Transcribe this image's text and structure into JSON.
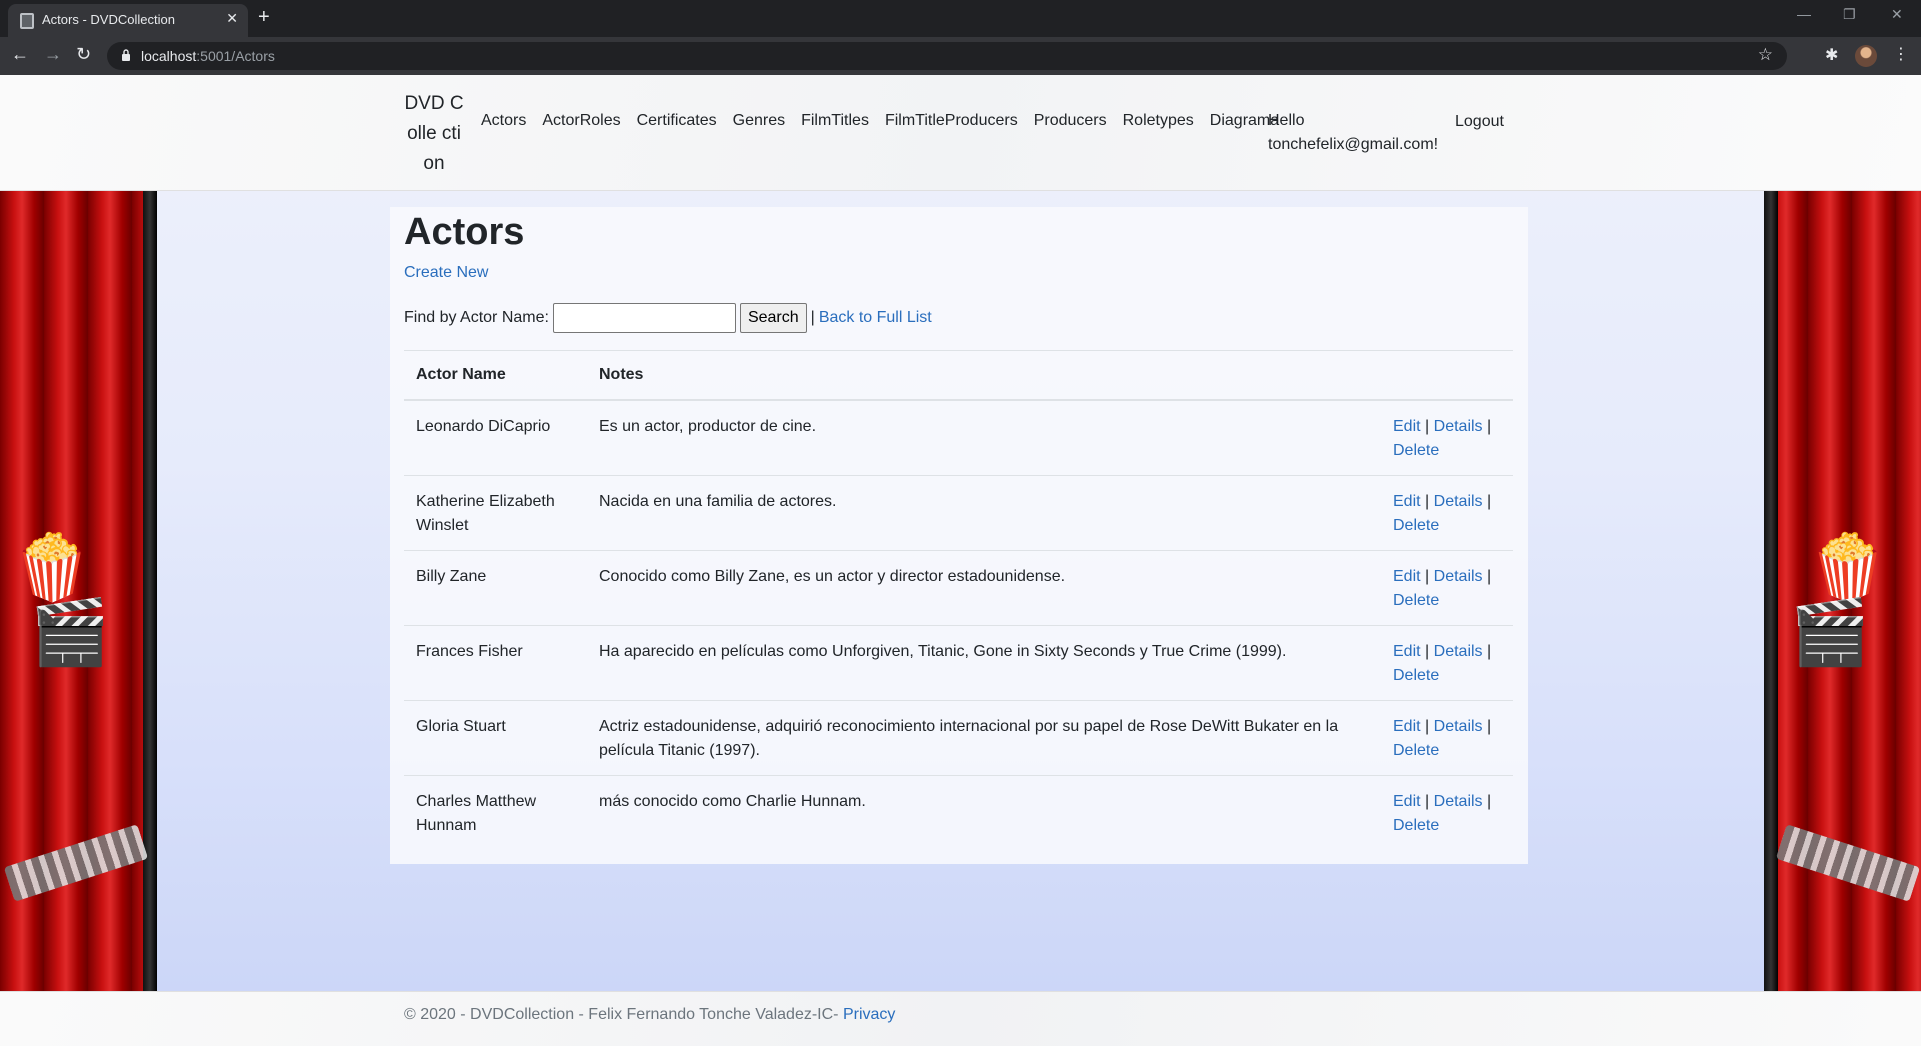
{
  "browser": {
    "tab_title": "Actors - DVDCollection",
    "url_host": "localhost",
    "url_rest": ":5001/Actors"
  },
  "site": {
    "brand": "DVD Colle ction",
    "nav": [
      "Actors",
      "ActorRoles",
      "Certificates",
      "Genres",
      "FilmTitles",
      "FilmTitleProducers",
      "Producers",
      "Roletypes",
      "Diagrama"
    ],
    "hello_line1": "Hello",
    "hello_line2": "tonchefelix@gmail.com!",
    "logout": "Logout"
  },
  "main": {
    "title": "Actors",
    "create_new": "Create New",
    "search_label": "Find by Actor Name:",
    "search_value": "",
    "search_button": "Search",
    "separator": "|",
    "back_link": "Back to Full List",
    "columns": [
      "Actor Name",
      "Notes"
    ],
    "rows": [
      {
        "name": "Leonardo DiCaprio",
        "notes": "Es un actor, productor de cine."
      },
      {
        "name": "Katherine Elizabeth Winslet",
        "notes": "Nacida en una familia de actores."
      },
      {
        "name": "Billy Zane",
        "notes": "Conocido como Billy Zane, es un actor y director estadounidense."
      },
      {
        "name": "Frances Fisher",
        "notes": "Ha aparecido en películas como Unforgiven, Titanic, Gone in Sixty Seconds y True Crime (1999)."
      },
      {
        "name": "Gloria Stuart",
        "notes": "Actriz estadounidense, adquirió reconocimiento internacional por su papel de Rose DeWitt Bukater en la película Titanic (1997)."
      },
      {
        "name": "Charles Matthew Hunnam",
        "notes": "más conocido como Charlie Hunnam."
      }
    ],
    "actions": {
      "edit": "Edit",
      "details": "Details",
      "delete": "Delete",
      "sep": "|"
    }
  },
  "footer": {
    "text": "© 2020 - DVDCollection - Felix Fernando Tonche Valadez-IC-",
    "privacy": "Privacy"
  },
  "colors": {
    "link": "#2a6ebd",
    "text": "#212529",
    "curtain": "#c81010"
  }
}
